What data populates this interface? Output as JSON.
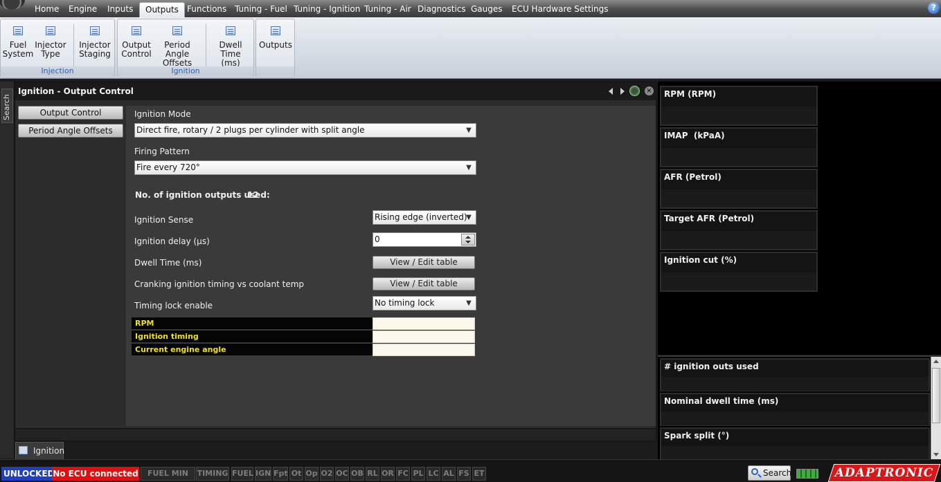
{
  "menu": {
    "items": [
      "Home",
      "Engine",
      "Inputs",
      "Outputs",
      "Functions",
      "Tuning - Fuel",
      "Tuning - Ignition",
      "Tuning - Air",
      "Diagnostics",
      "Gauges",
      "ECU Hardware Settings"
    ],
    "active": "Outputs",
    "help_icon": "?"
  },
  "ribbon": {
    "groups": [
      {
        "label": "Injection",
        "buttons": [
          "Fuel\nSystem",
          "Injector\nType",
          "Injector\nStaging"
        ]
      },
      {
        "label": "Ignition",
        "buttons": [
          "Output\nControl",
          "Period Angle\nOffsets",
          "Dwell Time\n(ms)"
        ]
      },
      {
        "label": "",
        "buttons": [
          "Outputs"
        ]
      }
    ]
  },
  "search_strip": {
    "label": "Search"
  },
  "panel": {
    "title": "Ignition - Output Control",
    "nav": [
      "Output Control",
      "Period Angle Offsets"
    ]
  },
  "form": {
    "ignition_mode_label": "Ignition Mode",
    "ignition_mode_value": "Direct fire, rotary / 2 plugs per cylinder with split angle",
    "firing_pattern_label": "Firing Pattern",
    "firing_pattern_value": "Fire every 720°",
    "outputs_used_label": "No. of ignition outputs used:",
    "outputs_used_value": "12",
    "ignition_sense_label": "Ignition Sense",
    "ignition_sense_value": "Rising edge (inverted)",
    "ignition_delay_label": "Ignition delay (µs)",
    "ignition_delay_value": "0",
    "dwell_time_label": "Dwell Time (ms)",
    "dwell_time_button": "View / Edit table",
    "cranking_label": "Cranking ignition timing vs coolant temp",
    "cranking_button": "View / Edit table",
    "timing_lock_label": "Timing lock enable",
    "timing_lock_value": "No timing lock"
  },
  "live_values": [
    {
      "label": "RPM",
      "value": ""
    },
    {
      "label": "Ignition timing",
      "value": ""
    },
    {
      "label": "Current engine angle",
      "value": ""
    }
  ],
  "doc_tab": {
    "label": "Ignition"
  },
  "gauges_top": [
    "RPM (RPM)",
    "IMAP  (kPaA)",
    "AFR (Petrol)",
    "Target AFR (Petrol)",
    "Ignition cut (%)"
  ],
  "gauges_bottom": [
    "# ignition outs used",
    "Nominal dwell time (ms)",
    "Spark split (°)"
  ],
  "status": {
    "lock": "UNLOCKED",
    "connection": "No ECU connected",
    "flags": [
      "FUEL MIN PW",
      "TIMING",
      "FUEL",
      "IGN",
      "Fpt",
      "Ot",
      "Op",
      "O2",
      "OC",
      "OB",
      "RL",
      "OR",
      "FC",
      "PL",
      "LC",
      "AL",
      "FS",
      "ET"
    ],
    "search_label": "Search",
    "logo_text": "ADAPTRONIC"
  },
  "colors": {
    "live_label": "#f0e21e",
    "unlocked_bg": "#1f3fbf",
    "no_ecu_bg": "#e01010",
    "ribbon_group_label": "#2a5db0"
  }
}
